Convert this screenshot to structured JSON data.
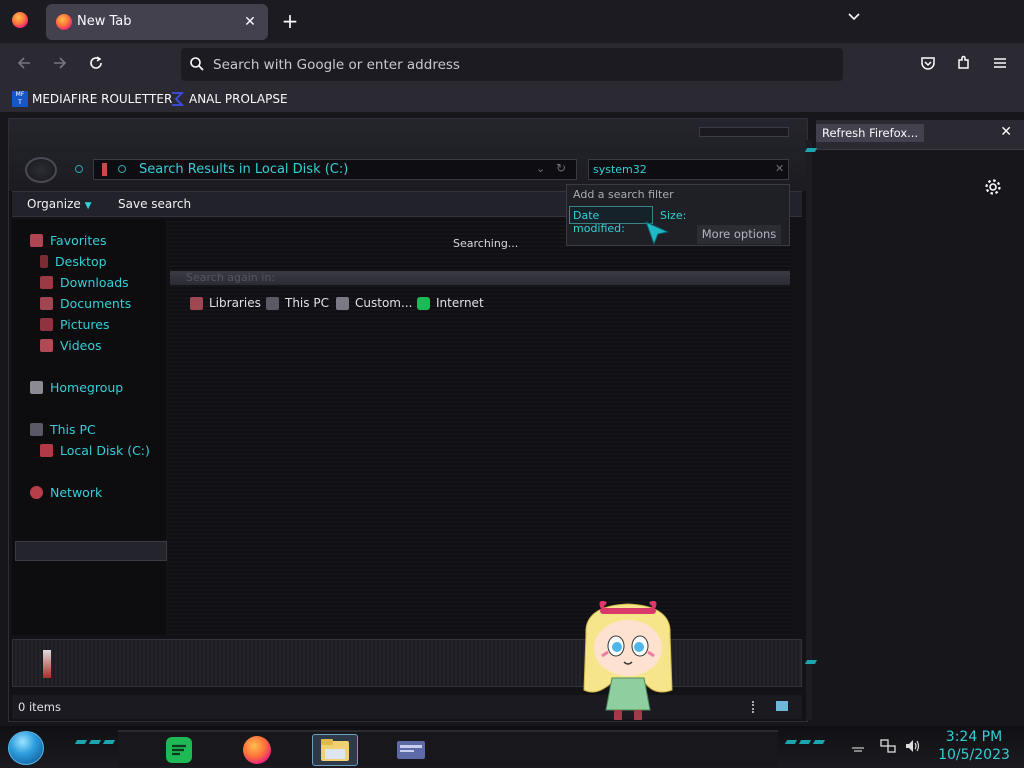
{
  "browser": {
    "tab_title": "New Tab",
    "tab_close": "✕",
    "new_tab": "+",
    "url_placeholder": "Search with Google or enter address",
    "bookmarks": [
      {
        "label": "MEDIAFIRE ROULETTER"
      },
      {
        "label": "ANAL PROLAPSE"
      }
    ],
    "notification": {
      "button": "Refresh Firefox...",
      "close": "✕"
    }
  },
  "explorer": {
    "address": "Search Results in Local Disk (C:)",
    "search_value": "system32",
    "toolbar": {
      "organize": "Organize",
      "save_search": "Save search"
    },
    "nav": [
      {
        "label": "Favorites"
      },
      {
        "label": "Desktop"
      },
      {
        "label": "Downloads"
      },
      {
        "label": "Documents"
      },
      {
        "label": "Pictures"
      },
      {
        "label": "Videos"
      },
      {
        "label": "Homegroup"
      },
      {
        "label": "This PC"
      },
      {
        "label": "Local Disk (C:)"
      },
      {
        "label": "Network"
      }
    ],
    "searching": "Searching...",
    "search_again": "Search again in:",
    "locations": [
      {
        "label": "Libraries"
      },
      {
        "label": "This PC"
      },
      {
        "label": "Custom..."
      },
      {
        "label": "Internet"
      }
    ],
    "filter": {
      "header": "Add a search filter",
      "date_modified": "Date modified:",
      "size": "Size:",
      "more_options": "More options"
    },
    "status": "0 items"
  },
  "taskbar": {
    "time": "3:24 PM",
    "date": "10/5/2023"
  },
  "colors": {
    "accent": "#33d0d6",
    "browser_bg": "#2b2a33"
  }
}
